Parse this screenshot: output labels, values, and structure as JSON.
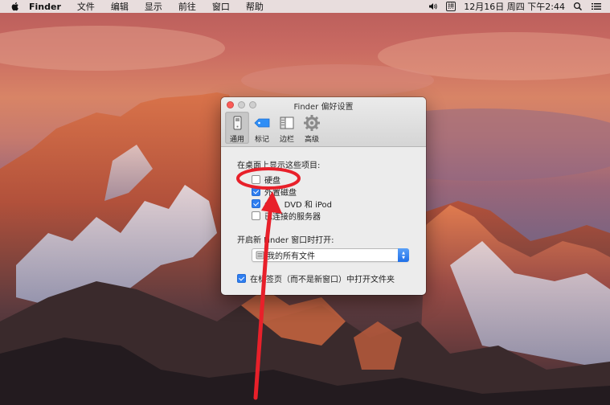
{
  "menubar": {
    "app": "Finder",
    "menus": [
      "文件",
      "编辑",
      "显示",
      "前往",
      "窗口",
      "帮助"
    ],
    "input_method": "拼",
    "clock": "12月16日 周四 下午2:44"
  },
  "window": {
    "title": "Finder 偏好设置",
    "tabs": [
      {
        "label": "通用",
        "icon": "device-icon",
        "active": true
      },
      {
        "label": "标记",
        "icon": "tag-icon",
        "active": false
      },
      {
        "label": "边栏",
        "icon": "sidebar-icon",
        "active": false
      },
      {
        "label": "高级",
        "icon": "gear-icon",
        "active": false
      }
    ],
    "desktop_section_label": "在桌面上显示这些项目:",
    "desktop_items": [
      {
        "label": "硬盘",
        "checked": false
      },
      {
        "label": "外置磁盘",
        "checked": true
      },
      {
        "label": "CD、DVD 和 iPod",
        "checked": true
      },
      {
        "label": "已连接的服务器",
        "checked": false
      }
    ],
    "new_window_label": "开启新 Finder 窗口时打开:",
    "new_window_value": "我的所有文件",
    "tabs_option": {
      "label": "在标签页（而不是新窗口）中打开文件夹",
      "checked": true
    }
  },
  "colors": {
    "accent": "#2f7ef0",
    "annotation": "#e8202a"
  }
}
